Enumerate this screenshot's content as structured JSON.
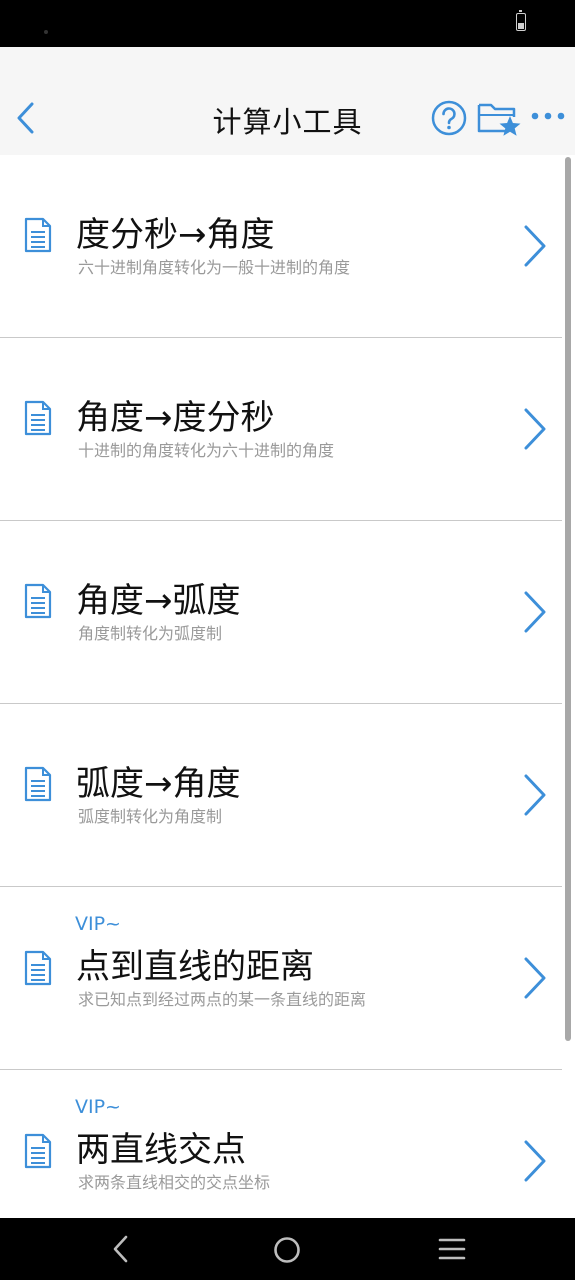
{
  "header": {
    "title": "计算小工具"
  },
  "icons": {
    "back": "chevron-left-icon",
    "help": "question-circle-icon",
    "favorites": "folder-star-icon",
    "more": "more-horizontal-icon",
    "document": "document-icon",
    "chevron": "chevron-right-icon"
  },
  "colors": {
    "accent": "#3d8fd9",
    "title_text": "#111111",
    "desc_text": "#9a9a9a",
    "header_bg": "#f6f6f6"
  },
  "items": [
    {
      "title": "度分秒→角度",
      "desc": "六十进制角度转化为一般十进制的角度",
      "vip": ""
    },
    {
      "title": "角度→度分秒",
      "desc": "十进制的角度转化为六十进制的角度",
      "vip": ""
    },
    {
      "title": "角度→弧度",
      "desc": "角度制转化为弧度制",
      "vip": ""
    },
    {
      "title": "弧度→角度",
      "desc": "弧度制转化为角度制",
      "vip": ""
    },
    {
      "title": "点到直线的距离",
      "desc": "求已知点到经过两点的某一条直线的距离",
      "vip": "VIP~"
    },
    {
      "title": "两直线交点",
      "desc": "求两条直线相交的交点坐标",
      "vip": "VIP~"
    }
  ]
}
